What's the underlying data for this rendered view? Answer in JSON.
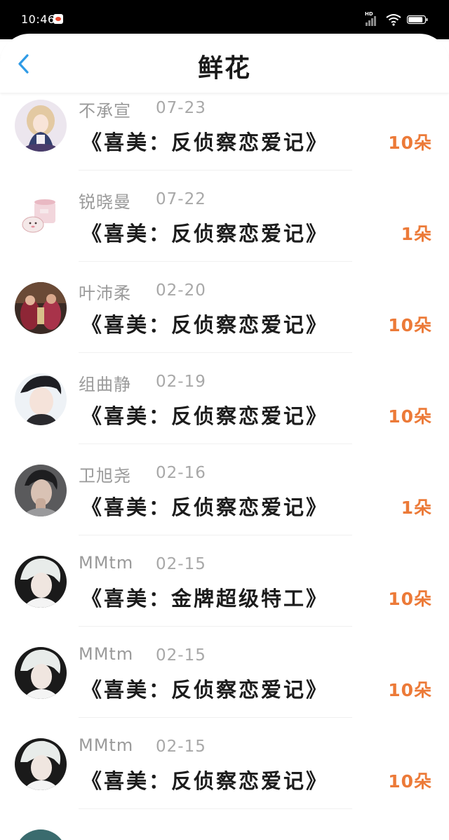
{
  "status_bar": {
    "time": "10:46",
    "network": "HD",
    "battery": "89"
  },
  "header": {
    "title": "鲜花",
    "back_icon": "chevron-left-icon"
  },
  "colors": {
    "accent_blue": "#2f9be6",
    "count_orange": "#ec7a38",
    "name_gray": "#9a9a9a"
  },
  "items": [
    {
      "name": "不承宣",
      "date": "07-23",
      "title": "《喜美：反侦察恋爱记》",
      "count": "10朵"
    },
    {
      "name": "锐晓曼",
      "date": "07-22",
      "title": "《喜美：反侦察恋爱记》",
      "count": "1朵"
    },
    {
      "name": "叶沛柔",
      "date": "02-20",
      "title": "《喜美：反侦察恋爱记》",
      "count": "10朵"
    },
    {
      "name": "组曲静",
      "date": "02-19",
      "title": "《喜美：反侦察恋爱记》",
      "count": "10朵"
    },
    {
      "name": "卫旭尧",
      "date": "02-16",
      "title": "《喜美：反侦察恋爱记》",
      "count": "1朵"
    },
    {
      "name": "MMtm",
      "date": "02-15",
      "title": "《喜美：金牌超级特工》",
      "count": "10朵"
    },
    {
      "name": "MMtm",
      "date": "02-15",
      "title": "《喜美：反侦察恋爱记》",
      "count": "10朵"
    },
    {
      "name": "MMtm",
      "date": "02-15",
      "title": "《喜美：反侦察恋爱记》",
      "count": "10朵"
    }
  ]
}
